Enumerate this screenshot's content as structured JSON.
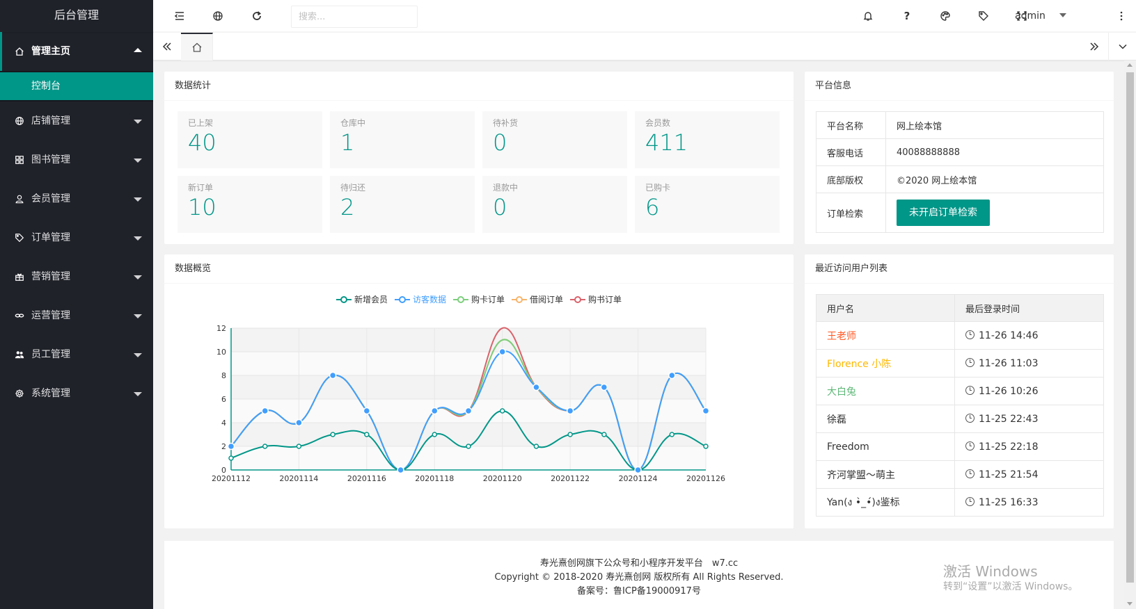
{
  "app": {
    "title": "后台管理"
  },
  "sidebar": {
    "items": [
      {
        "label": "管理主页",
        "icon": "home-icon",
        "open": true,
        "sub": [
          "控制台"
        ]
      },
      {
        "label": "店铺管理",
        "icon": "globe-icon"
      },
      {
        "label": "图书管理",
        "icon": "apps-icon"
      },
      {
        "label": "会员管理",
        "icon": "user-icon"
      },
      {
        "label": "订单管理",
        "icon": "tag-icon"
      },
      {
        "label": "营销管理",
        "icon": "gift-icon"
      },
      {
        "label": "运营管理",
        "icon": "link-icon"
      },
      {
        "label": "员工管理",
        "icon": "group-icon"
      },
      {
        "label": "系统管理",
        "icon": "settings-icon"
      }
    ]
  },
  "header": {
    "search_placeholder": "搜索...",
    "help_label": "?",
    "user": "admin"
  },
  "stats": {
    "title": "数据统计",
    "items": [
      {
        "label": "已上架",
        "value": "40"
      },
      {
        "label": "仓库中",
        "value": "1"
      },
      {
        "label": "待补货",
        "value": "0"
      },
      {
        "label": "会员数",
        "value": "411"
      },
      {
        "label": "新订单",
        "value": "10"
      },
      {
        "label": "待归还",
        "value": "2"
      },
      {
        "label": "退款中",
        "value": "0"
      },
      {
        "label": "已购卡",
        "value": "6"
      }
    ]
  },
  "platform": {
    "title": "平台信息",
    "rows": [
      {
        "key": "平台名称",
        "value": "网上绘本馆"
      },
      {
        "key": "客服电话",
        "value": "40088888888"
      },
      {
        "key": "底部版权",
        "value": "©2020 网上绘本馆"
      },
      {
        "key": "订单检索",
        "button": "未开启订单检索"
      }
    ]
  },
  "overview": {
    "title": "数据概览"
  },
  "chart_data": {
    "type": "line",
    "categories": [
      "20201112",
      "20201113",
      "20201114",
      "20201115",
      "20201116",
      "20201117",
      "20201118",
      "20201119",
      "20201120",
      "20201121",
      "20201122",
      "20201123",
      "20201124",
      "20201125",
      "20201126"
    ],
    "x_tick_labels": [
      "20201112",
      "20201114",
      "20201116",
      "20201118",
      "20201120",
      "20201122",
      "20201124",
      "20201126"
    ],
    "y_ticks": [
      0,
      2,
      4,
      6,
      8,
      10,
      12
    ],
    "ylim": [
      0,
      12
    ],
    "smooth": true,
    "grid": true,
    "legend_position": "top-center",
    "series": [
      {
        "name": "新增会员",
        "color": "#009688",
        "values": [
          1,
          2,
          2,
          3,
          3,
          0,
          3,
          2,
          5,
          2,
          3,
          3,
          0,
          3,
          2
        ]
      },
      {
        "name": "访客数据",
        "color": "#409eff",
        "highlight": true,
        "values": [
          2,
          5,
          4,
          8,
          5,
          0,
          5,
          5,
          10,
          7,
          5,
          7,
          0,
          8,
          5
        ]
      },
      {
        "name": "购卡订单",
        "color": "#7ccf7c",
        "values": [
          2,
          5,
          4,
          8,
          5,
          0,
          5,
          5,
          11,
          7,
          5,
          7,
          0,
          8,
          5
        ]
      },
      {
        "name": "借阅订单",
        "color": "#f7b46a",
        "values": [
          2,
          5,
          4,
          8,
          5,
          0,
          5,
          5,
          11,
          7,
          5,
          7,
          0,
          8,
          5
        ]
      },
      {
        "name": "购书订单",
        "color": "#d9626b",
        "values": [
          2,
          5,
          4,
          8,
          5,
          0,
          5,
          5,
          12,
          7,
          5,
          7,
          0,
          8,
          5
        ]
      }
    ]
  },
  "recent_users": {
    "title": "最近访问用户列表",
    "columns": [
      "用户名",
      "最后登录时间"
    ],
    "rows": [
      {
        "name": "王老师",
        "time": "11-26 14:46",
        "color": "#ff5722"
      },
      {
        "name": "Florence 小陈",
        "time": "11-26 11:03",
        "color": "#ffb800"
      },
      {
        "name": "大白兔",
        "time": "11-26 10:26",
        "color": "#5fb878"
      },
      {
        "name": "徐磊",
        "time": "11-25 22:43",
        "color": "#333333"
      },
      {
        "name": "Freedom",
        "time": "11-25 22:18",
        "color": "#333333"
      },
      {
        "name": "齐河掌盟～萌主",
        "time": "11-25 21:54",
        "color": "#333333"
      },
      {
        "name": "Yan(ง •̀_•́)ง鉴标",
        "time": "11-25 16:33",
        "color": "#333333"
      }
    ]
  },
  "footer": {
    "line1": "寿光熹创网旗下公众号和小程序开发平台　w7.cc",
    "line2": "Copyright © 2018-2020 寿光熹创网 版权所有 All Rights Reserved.",
    "line3": "备案号：鲁ICP备19000917号"
  },
  "watermark": {
    "line1": "激活 Windows",
    "line2": "转到“设置”以激活 Windows。"
  },
  "colors": {
    "accent": "#009688",
    "sidebar_bg": "#20222a"
  }
}
